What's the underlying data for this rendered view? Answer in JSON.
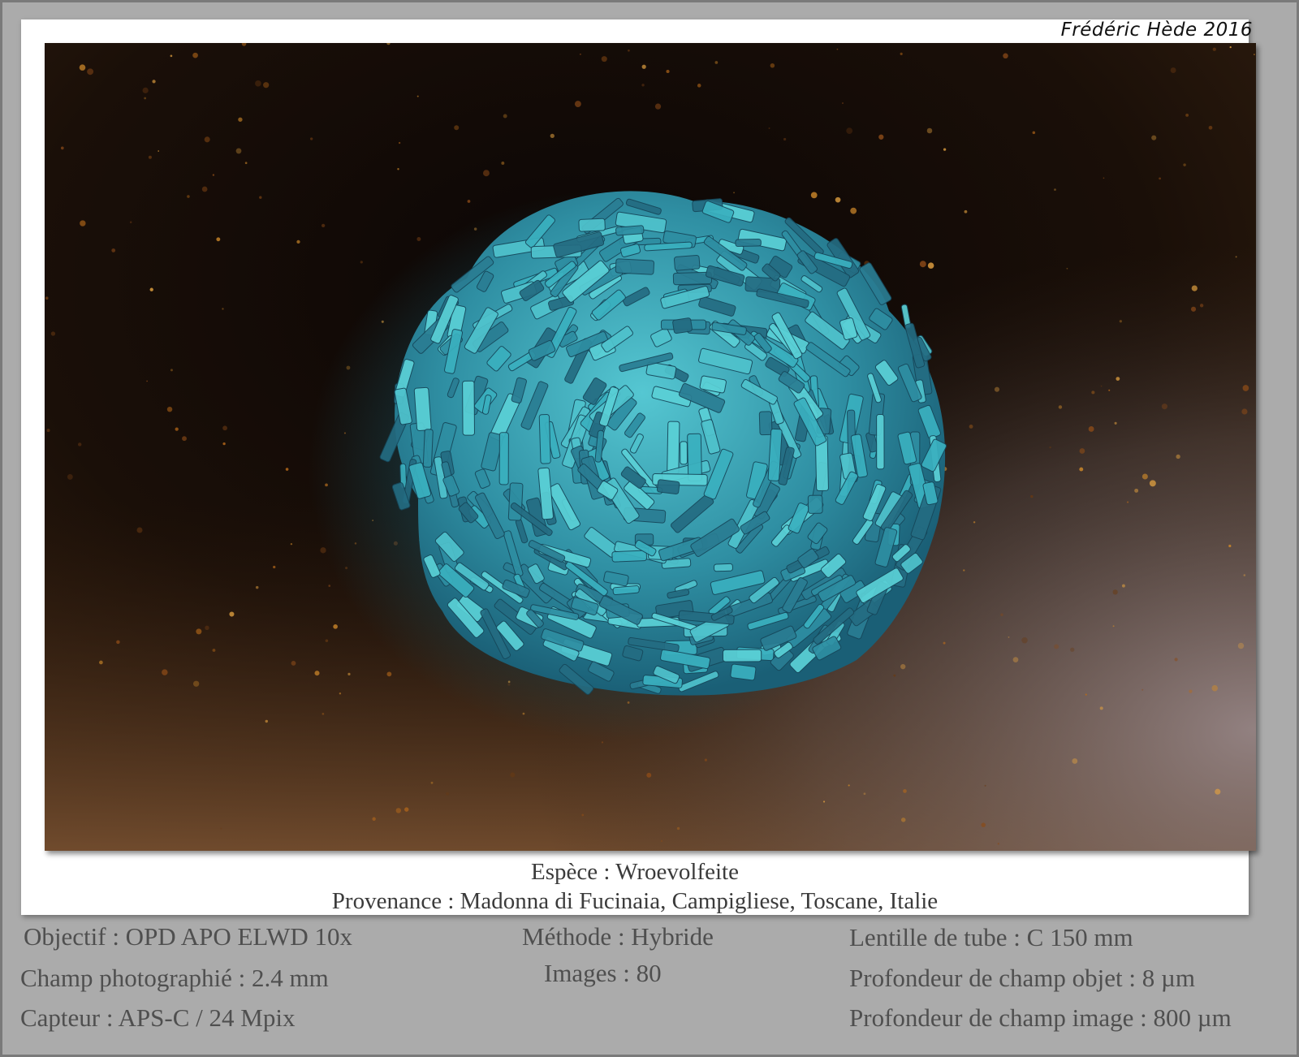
{
  "signature": "Frédéric Hède 2016",
  "caption": {
    "species": "Espèce : Wroevolfeite",
    "provenance": "Provenance : Madonna di Fucinaia, Campigliese, Toscane, Italie"
  },
  "specs": {
    "objective": "Objectif : OPD APO ELWD 10x",
    "field": "Champ photographié : 2.4 mm",
    "sensor": "Capteur : APS-C / 24 Mpix",
    "method": "Méthode : Hybride",
    "images": "Images : 80",
    "tube_lens": "Lentille de tube : C 150 mm",
    "object_dof": "Profondeur de champ objet : 8 µm",
    "image_dof": "Profondeur de champ image : 800 µm"
  },
  "colors": {
    "background_gray": "#ababab",
    "crystal_blue": "#3fa3b4",
    "matrix_dark": "#160c07",
    "matrix_brown": "#6b4220"
  }
}
